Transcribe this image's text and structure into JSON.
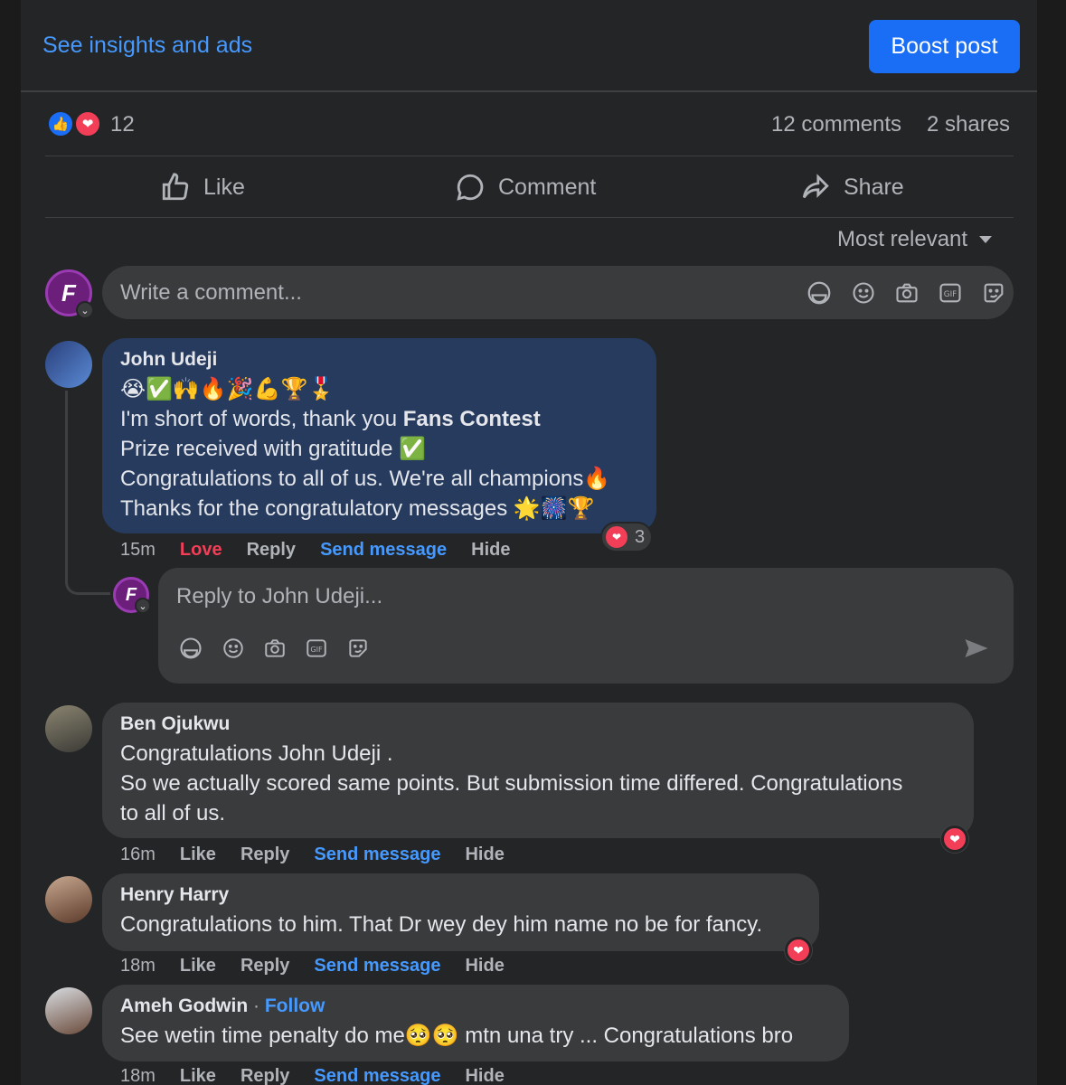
{
  "top_bar": {
    "insights_link": "See insights and ads",
    "boost_button": "Boost post"
  },
  "summary": {
    "reaction_count": "12",
    "comments": "12 comments",
    "shares": "2 shares",
    "reaction_icons": [
      "like-icon",
      "love-icon"
    ]
  },
  "actions": {
    "like": "Like",
    "comment": "Comment",
    "share": "Share"
  },
  "sort": {
    "label": "Most relevant"
  },
  "composer": {
    "placeholder": "Write a comment...",
    "avatar_letter": "F"
  },
  "comments": [
    {
      "author": "John Udeji",
      "emoji_line": "😭✅🙌🔥🎉💪🏆🎖️",
      "text_before_bold": "I'm short of words, thank you ",
      "bold": "Fans Contest",
      "line2": "Prize received with gratitude ✅",
      "line3": "Congratulations to all of us. We're all champions🔥",
      "line4": "Thanks for the congratulatory messages 🌟🎆🏆",
      "reaction_count": "3",
      "time": "15m",
      "reaction_label": "Love",
      "reply": "Reply",
      "send_message": "Send message",
      "hide": "Hide"
    },
    {
      "author": "Ben Ojukwu",
      "text": "Congratulations John Udeji .",
      "text2": "So we actually scored same points. But submission time differed. Congratulations",
      "text3": "to all of us.",
      "time": "16m",
      "reaction_label": "Like",
      "reply": "Reply",
      "send_message": "Send message",
      "hide": "Hide"
    },
    {
      "author": "Henry Harry",
      "text": "Congratulations to him. That Dr wey dey him name no be for fancy.",
      "time": "18m",
      "reaction_label": "Like",
      "reply": "Reply",
      "send_message": "Send message",
      "hide": "Hide"
    },
    {
      "author": "Ameh Godwin",
      "separator": " · ",
      "follow": "Follow",
      "text": "See wetin time penalty do me🥺🥺 mtn una try ... Congratulations bro",
      "time": "18m",
      "reaction_label": "Like",
      "reply": "Reply",
      "send_message": "Send message",
      "hide": "Hide"
    }
  ],
  "reply_box": {
    "placeholder": "Reply to John Udeji..."
  },
  "colors": {
    "background": "#242526",
    "accent": "#1a6ef5",
    "link": "#4599ff",
    "love": "#f33e58",
    "highlight_bubble": "#263b5e"
  }
}
